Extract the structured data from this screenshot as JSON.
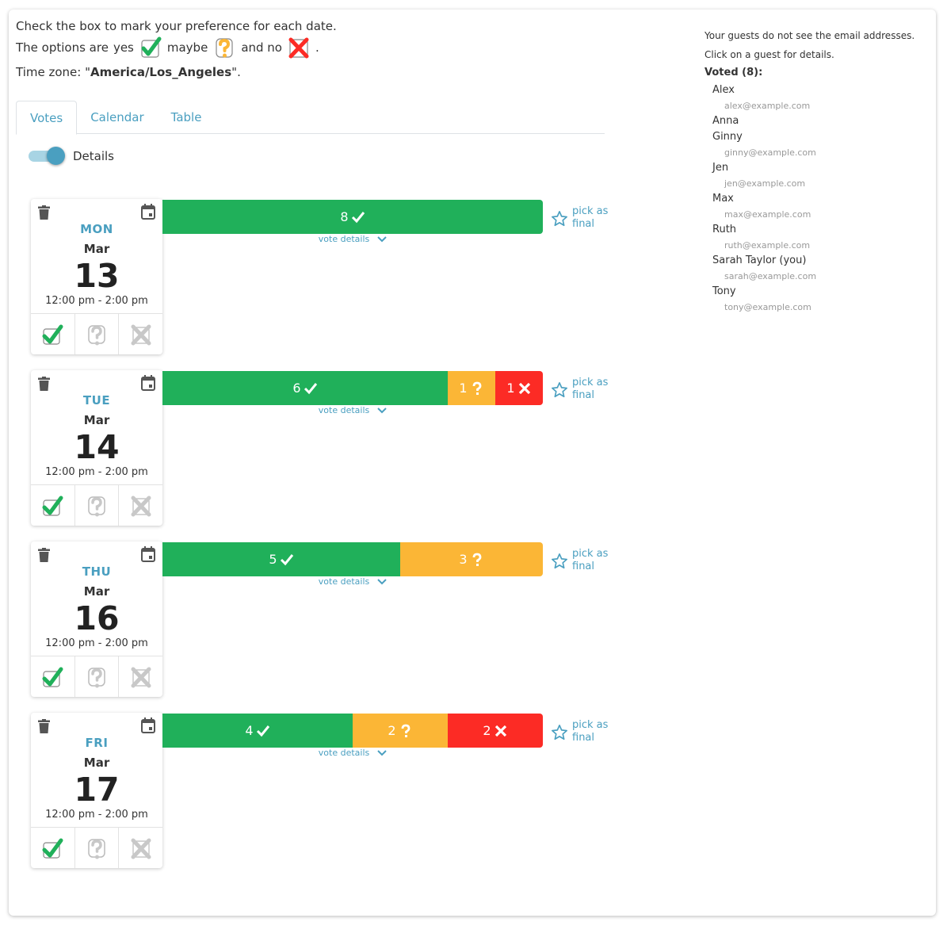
{
  "intro": {
    "instruction": "Check the box to mark your preference for each date.",
    "options_prefix": "The options are",
    "yes_label": "yes",
    "maybe_label": "maybe",
    "no_label": "and no",
    "options_suffix": ".",
    "timezone_prefix": "Time zone: \"",
    "timezone": "America/Los_Angeles",
    "timezone_suffix": "\"."
  },
  "tabs": [
    {
      "label": "Votes",
      "active": true
    },
    {
      "label": "Calendar",
      "active": false
    },
    {
      "label": "Table",
      "active": false
    }
  ],
  "toggle": {
    "label": "Details",
    "on": true
  },
  "colors": {
    "yes": "#20b05a",
    "maybe": "#fbb636",
    "no": "#fc2b25",
    "accent": "#4a9fc0"
  },
  "dates": [
    {
      "dow": "MON",
      "month": "Mar",
      "day": "13",
      "time": "12:00 pm - 2:00 pm",
      "selection": "yes",
      "votes": {
        "yes": 8,
        "maybe": 0,
        "no": 0
      },
      "total": 8,
      "vote_details": "vote details",
      "pick_label": "pick as final"
    },
    {
      "dow": "TUE",
      "month": "Mar",
      "day": "14",
      "time": "12:00 pm - 2:00 pm",
      "selection": "yes",
      "votes": {
        "yes": 6,
        "maybe": 1,
        "no": 1
      },
      "total": 8,
      "vote_details": "vote details",
      "pick_label": "pick as final"
    },
    {
      "dow": "THU",
      "month": "Mar",
      "day": "16",
      "time": "12:00 pm - 2:00 pm",
      "selection": "yes",
      "votes": {
        "yes": 5,
        "maybe": 3,
        "no": 0
      },
      "total": 8,
      "vote_details": "vote details",
      "pick_label": "pick as final"
    },
    {
      "dow": "FRI",
      "month": "Mar",
      "day": "17",
      "time": "12:00 pm - 2:00 pm",
      "selection": "yes",
      "votes": {
        "yes": 4,
        "maybe": 2,
        "no": 2
      },
      "total": 8,
      "vote_details": "vote details",
      "pick_label": "pick as final"
    }
  ],
  "sidebar": {
    "note1": "Your guests do not see the email addresses.",
    "note2": "Click on a guest for details.",
    "voted_label": "Voted (8):",
    "guests": [
      {
        "name": "Alex",
        "email": "alex@example.com"
      },
      {
        "name": "Anna",
        "email": ""
      },
      {
        "name": "Ginny",
        "email": "ginny@example.com"
      },
      {
        "name": "Jen",
        "email": "jen@example.com"
      },
      {
        "name": "Max",
        "email": "max@example.com"
      },
      {
        "name": "Ruth",
        "email": "ruth@example.com"
      },
      {
        "name": "Sarah Taylor (you)",
        "email": "sarah@example.com"
      },
      {
        "name": "Tony",
        "email": "tony@example.com"
      }
    ]
  }
}
